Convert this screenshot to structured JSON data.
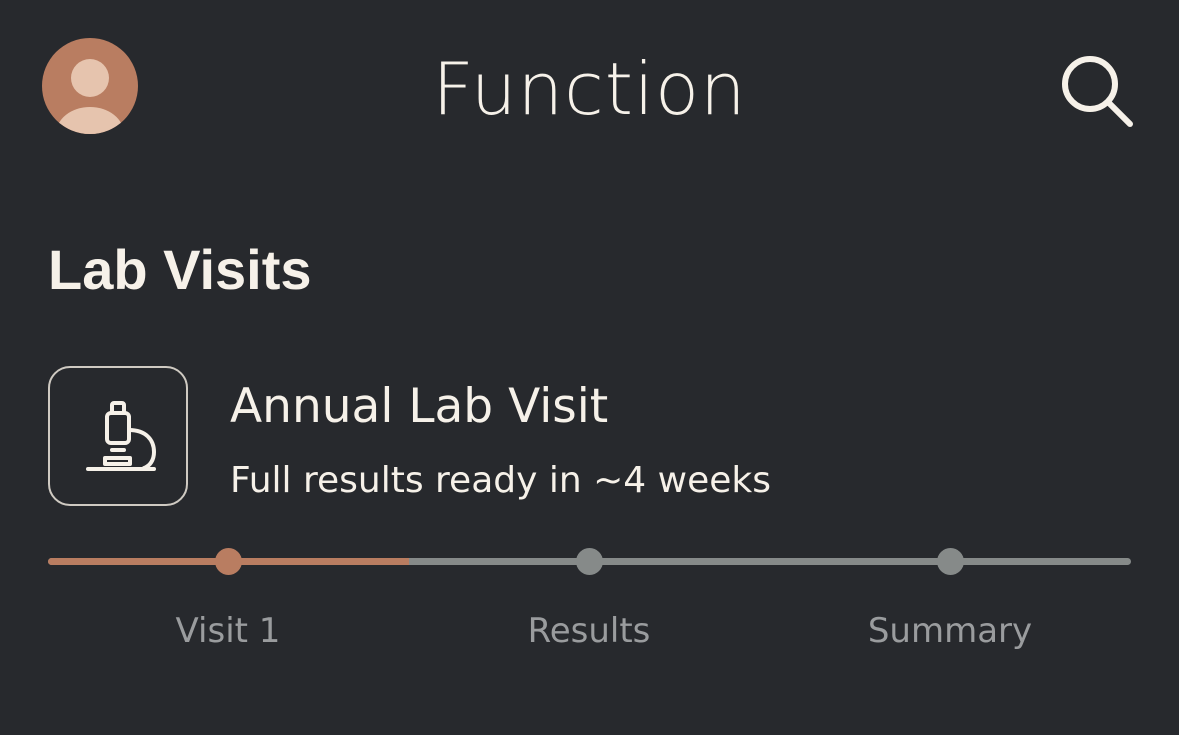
{
  "header": {
    "title": "Function",
    "avatar_icon": "user-avatar-icon",
    "search_icon": "search-icon"
  },
  "section": {
    "title": "Lab Visits"
  },
  "visit": {
    "icon": "microscope-icon",
    "title": "Annual Lab Visit",
    "subtitle": "Full results ready in ~4 weeks"
  },
  "progress": {
    "completed_fraction": 0.333,
    "steps": [
      {
        "label": "Visit 1",
        "status": "done"
      },
      {
        "label": "Results",
        "status": "pending"
      },
      {
        "label": "Summary",
        "status": "pending"
      }
    ]
  },
  "colors": {
    "background": "#27292d",
    "accent": "#b97d61",
    "inactive": "#868a89",
    "text": "#f6f1e9",
    "muted_text": "#9a9c9e"
  }
}
